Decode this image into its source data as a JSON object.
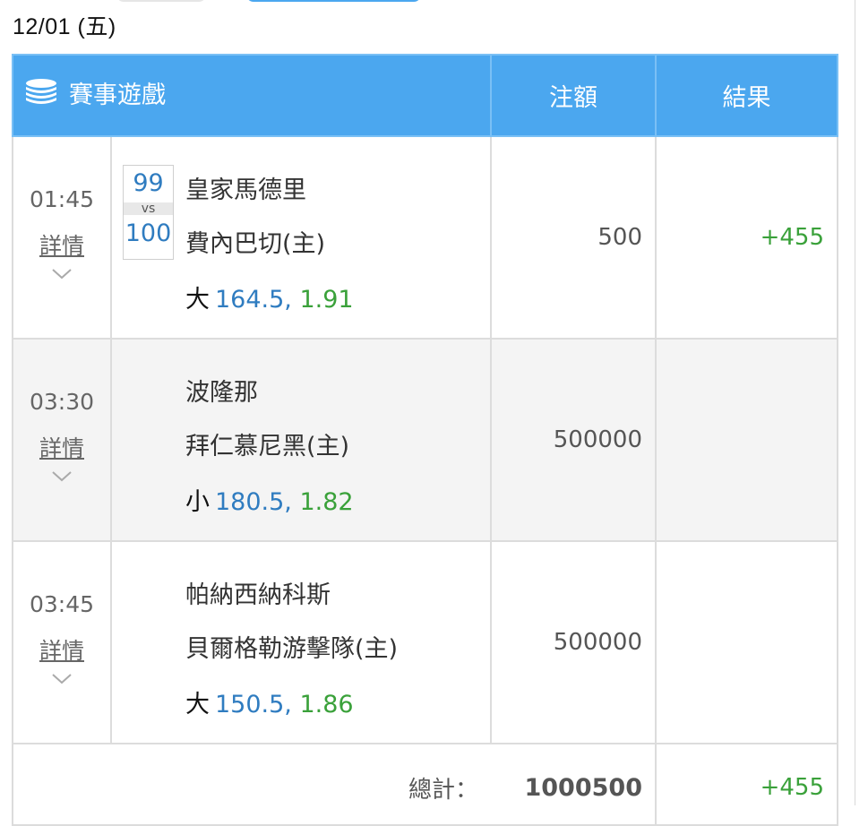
{
  "date": "12/01 (五)",
  "colors": {
    "header_bg": "#4ba7ef",
    "win_green": "#3aa13a",
    "line_blue": "#2f7cc0"
  },
  "table": {
    "header": {
      "game": "賽事遊戲",
      "amount": "注額",
      "result": "結果",
      "icon": "coin-stack-icon"
    },
    "rows": [
      {
        "time": "01:45",
        "detail": "詳情",
        "score_home": "99",
        "vs": "vs",
        "score_away": "100",
        "team_home": "皇家馬德里",
        "team_away": "費內巴切(主)",
        "pick": "大",
        "line": "164.5,",
        "odds": "1.91",
        "amount": "500",
        "result": "+455"
      },
      {
        "time": "03:30",
        "detail": "詳情",
        "team_home": "波隆那",
        "team_away": "拜仁慕尼黑(主)",
        "pick": "小",
        "line": "180.5,",
        "odds": "1.82",
        "amount": "500000",
        "result": ""
      },
      {
        "time": "03:45",
        "detail": "詳情",
        "team_home": "帕納西納科斯",
        "team_away": "貝爾格勒游擊隊(主)",
        "pick": "大",
        "line": "150.5,",
        "odds": "1.86",
        "amount": "500000",
        "result": ""
      }
    ],
    "total": {
      "label": "總計：",
      "amount": "1000500",
      "result": "+455"
    }
  }
}
